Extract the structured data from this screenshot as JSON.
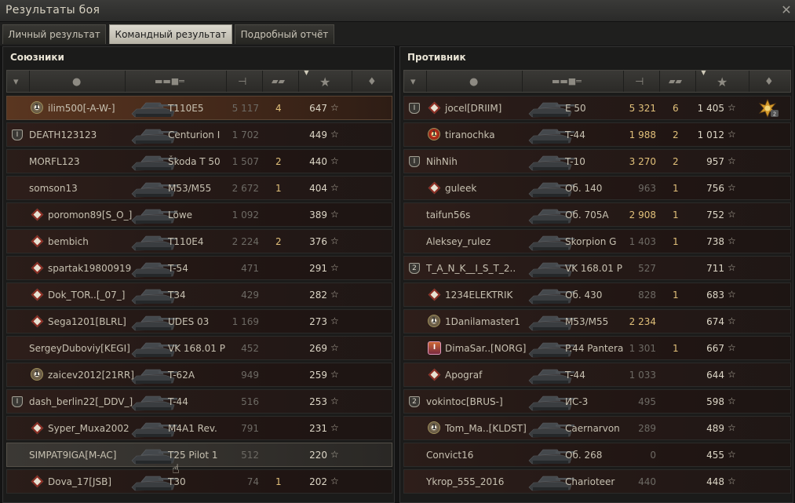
{
  "window": {
    "title": "Результаты боя",
    "close_icon": "close-icon"
  },
  "tabs": [
    {
      "label": "Личный результат",
      "active": false
    },
    {
      "label": "Командный результат",
      "active": true
    },
    {
      "label": "Подробный отчёт",
      "active": false
    }
  ],
  "columns": {
    "icons": [
      "platoon-icon",
      "player-icon",
      "tank-icon",
      "damage-icon",
      "frags-icon",
      "xp-star-icon",
      "medal-icon"
    ],
    "sorted": "xp"
  },
  "allies": {
    "title": "Союзники",
    "rows": [
      {
        "platoon": "",
        "badge": "circ",
        "badge_text": "1",
        "player": "ilim500[-A-W-]",
        "tank": "T110E5",
        "damage": "5 117",
        "frags": "4",
        "xp": "647",
        "style": "mine"
      },
      {
        "platoon": "I",
        "badge": "",
        "badge_text": "",
        "player": "DEATH123123",
        "tank": "Centurion I",
        "damage": "1 702",
        "frags": "",
        "xp": "449",
        "style": ""
      },
      {
        "platoon": "",
        "badge": "",
        "badge_text": "",
        "player": "MORFL123",
        "tank": "Škoda T 50",
        "damage": "1 507",
        "frags": "2",
        "xp": "440",
        "style": "alt"
      },
      {
        "platoon": "",
        "badge": "",
        "badge_text": "",
        "player": "somson13",
        "tank": "M53/M55",
        "damage": "2 672",
        "frags": "1",
        "xp": "404",
        "style": ""
      },
      {
        "platoon": "",
        "badge": "dia",
        "badge_text": "",
        "player": "poromon89[S_O_]",
        "tank": "Löwe",
        "damage": "1 092",
        "frags": "",
        "xp": "389",
        "style": "alt"
      },
      {
        "platoon": "",
        "badge": "dia",
        "badge_text": "",
        "player": "bembich",
        "tank": "T110E4",
        "damage": "2 224",
        "frags": "2",
        "xp": "376",
        "style": ""
      },
      {
        "platoon": "",
        "badge": "dia",
        "badge_text": "",
        "player": "spartak19800919",
        "tank": "T-54",
        "damage": "471",
        "frags": "",
        "xp": "291",
        "style": "alt"
      },
      {
        "platoon": "",
        "badge": "dia",
        "badge_text": "",
        "player": "Dok_TOR..[_07_]",
        "tank": "T34",
        "damage": "429",
        "frags": "",
        "xp": "282",
        "style": ""
      },
      {
        "platoon": "",
        "badge": "dia",
        "badge_text": "",
        "player": "Sega1201[BLRL]",
        "tank": "UDES 03",
        "damage": "1 169",
        "frags": "",
        "xp": "273",
        "style": "alt"
      },
      {
        "platoon": "",
        "badge": "",
        "badge_text": "",
        "player": "SergeyDuboviy[KEGI]",
        "tank": "VK 168.01 P",
        "damage": "452",
        "frags": "",
        "xp": "269",
        "style": ""
      },
      {
        "platoon": "",
        "badge": "circ",
        "badge_text": "1",
        "player": "zaicev2012[21RR]",
        "tank": "T-62A",
        "damage": "949",
        "frags": "",
        "xp": "259",
        "style": "alt"
      },
      {
        "platoon": "I",
        "badge": "",
        "badge_text": "",
        "player": "dash_berlin22[_DDV_]",
        "tank": "T-44",
        "damage": "516",
        "frags": "",
        "xp": "253",
        "style": ""
      },
      {
        "platoon": "",
        "badge": "dia",
        "badge_text": "",
        "player": "Syper_Muxa2002",
        "tank": "M4A1 Rev.",
        "damage": "791",
        "frags": "",
        "xp": "231",
        "style": "alt"
      },
      {
        "platoon": "",
        "badge": "",
        "badge_text": "",
        "player": "SIMPAT9IGA[M-AC]",
        "tank": "T25 Pilot 1",
        "damage": "512",
        "frags": "",
        "xp": "220",
        "style": "hover"
      },
      {
        "platoon": "",
        "badge": "dia",
        "badge_text": "",
        "player": "Dova_17[JSB]",
        "tank": "T30",
        "damage": "74",
        "frags": "1",
        "xp": "202",
        "style": "alt"
      }
    ]
  },
  "enemies": {
    "title": "Противник",
    "rows": [
      {
        "platoon": "I",
        "badge": "dia",
        "badge_text": "",
        "player": "jocel[DRIIM]",
        "tank": "E 50",
        "damage": "5 321",
        "frags": "6",
        "xp": "1 405",
        "medal": "2",
        "style": ""
      },
      {
        "platoon": "",
        "badge": "circ-red",
        "badge_text": "1",
        "player": "tiranochka",
        "tank": "T-44",
        "damage": "1 988",
        "frags": "2",
        "xp": "1 012",
        "medal": "",
        "style": "alt"
      },
      {
        "platoon": "I",
        "badge": "",
        "badge_text": "",
        "player": "NihNih",
        "tank": "T-10",
        "damage": "3 270",
        "frags": "2",
        "xp": "957",
        "medal": "",
        "style": ""
      },
      {
        "platoon": "",
        "badge": "dia",
        "badge_text": "",
        "player": "guleek",
        "tank": "Об. 140",
        "damage": "963",
        "frags": "1",
        "xp": "756",
        "medal": "",
        "style": "alt"
      },
      {
        "platoon": "",
        "badge": "",
        "badge_text": "",
        "player": "taifun56s",
        "tank": "Об. 705А",
        "damage": "2 908",
        "frags": "1",
        "xp": "752",
        "medal": "",
        "style": ""
      },
      {
        "platoon": "",
        "badge": "",
        "badge_text": "",
        "player": "Aleksey_rulez",
        "tank": "Skorpion G",
        "damage": "1 403",
        "frags": "1",
        "xp": "738",
        "medal": "",
        "style": "alt"
      },
      {
        "platoon": "2",
        "badge": "",
        "badge_text": "",
        "player": "T_A_N_K__I_S_T_2..",
        "tank": "VK 168.01 P",
        "damage": "527",
        "frags": "",
        "xp": "711",
        "medal": "",
        "style": ""
      },
      {
        "platoon": "",
        "badge": "dia",
        "badge_text": "",
        "player": "1234ELEKTRIK",
        "tank": "Об. 430",
        "damage": "828",
        "frags": "1",
        "xp": "683",
        "medal": "",
        "style": "alt"
      },
      {
        "platoon": "",
        "badge": "circ",
        "badge_text": "1",
        "player": "1Danilamaster1",
        "tank": "M53/M55",
        "damage": "2 234",
        "frags": "",
        "xp": "674",
        "medal": "",
        "style": ""
      },
      {
        "platoon": "",
        "badge": "star",
        "badge_text": "I",
        "player": "DimaSar..[NORG]",
        "tank": "P.44 Pantera",
        "damage": "1 301",
        "frags": "1",
        "xp": "667",
        "medal": "",
        "style": "alt"
      },
      {
        "platoon": "",
        "badge": "dia",
        "badge_text": "",
        "player": "Apograf",
        "tank": "T-44",
        "damage": "1 033",
        "frags": "",
        "xp": "644",
        "medal": "",
        "style": ""
      },
      {
        "platoon": "2",
        "badge": "",
        "badge_text": "",
        "player": "vokintoc[BRUS-]",
        "tank": "ИС-3",
        "damage": "495",
        "frags": "",
        "xp": "598",
        "medal": "",
        "style": "alt"
      },
      {
        "platoon": "",
        "badge": "circ",
        "badge_text": "1",
        "player": "Tom_Ma..[KLDST]",
        "tank": "Caernarvon",
        "damage": "289",
        "frags": "",
        "xp": "489",
        "medal": "",
        "style": ""
      },
      {
        "platoon": "",
        "badge": "",
        "badge_text": "",
        "player": "Convict16",
        "tank": "Об. 268",
        "damage": "0",
        "frags": "",
        "xp": "455",
        "medal": "",
        "style": "alt"
      },
      {
        "platoon": "",
        "badge": "",
        "badge_text": "",
        "player": "Ykrop_555_2016",
        "tank": "Charioteer",
        "damage": "440",
        "frags": "",
        "xp": "448",
        "medal": "",
        "style": ""
      }
    ]
  },
  "colors": {
    "frags": "#e1c07a",
    "damage_highlight": "#e1c07a",
    "damage_dim": "#6d6a64",
    "mine_row": "#5a3620"
  }
}
